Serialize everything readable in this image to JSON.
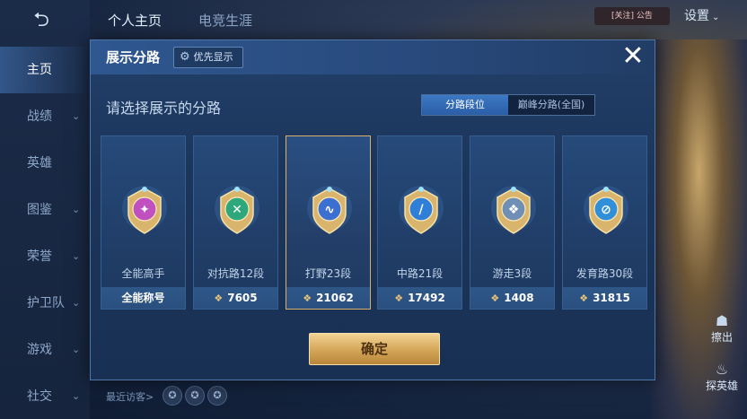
{
  "app": {
    "back_label": "⮌",
    "tabs": [
      "个人主页",
      "电竞生涯"
    ],
    "notice": "[关注] 公告",
    "settings_label": "设置"
  },
  "nav": {
    "items": [
      "主页",
      "战绩",
      "英雄",
      "图鉴",
      "荣誉",
      "护卫队",
      "游戏",
      "社交"
    ]
  },
  "side_buttons": {
    "upper": "擦出",
    "lower": "探英雄"
  },
  "visitors_label": "最近访客>",
  "modal": {
    "title": "展示分路",
    "priority_label": "优先显示",
    "close_label": "✕",
    "subtitle": "请选择展示的分路",
    "segments": [
      "分路段位",
      "巅峰分路(全国)"
    ],
    "active_segment": 0,
    "confirm_label": "确定",
    "selected_card": 2,
    "cards": [
      {
        "name": "全能高手",
        "foot": "全能称号",
        "points": null,
        "color": "#c04fbf",
        "glyph": "✦"
      },
      {
        "name": "对抗路12段",
        "foot": "7605",
        "points": true,
        "color": "#2fa77d",
        "glyph": "✕"
      },
      {
        "name": "打野23段",
        "foot": "21062",
        "points": true,
        "color": "#3b6fd1",
        "glyph": "∿"
      },
      {
        "name": "中路21段",
        "foot": "17492",
        "points": true,
        "color": "#2f7fd8",
        "glyph": "/"
      },
      {
        "name": "游走3段",
        "foot": "1408",
        "points": true,
        "color": "#6f8fb5",
        "glyph": "❖"
      },
      {
        "name": "发育路30段",
        "foot": "31815",
        "points": true,
        "color": "#2f8fd8",
        "glyph": "⊘"
      }
    ]
  },
  "colors": {
    "accent_gold": "#d8b06a",
    "active_tab_blue": "#3c79c4"
  }
}
